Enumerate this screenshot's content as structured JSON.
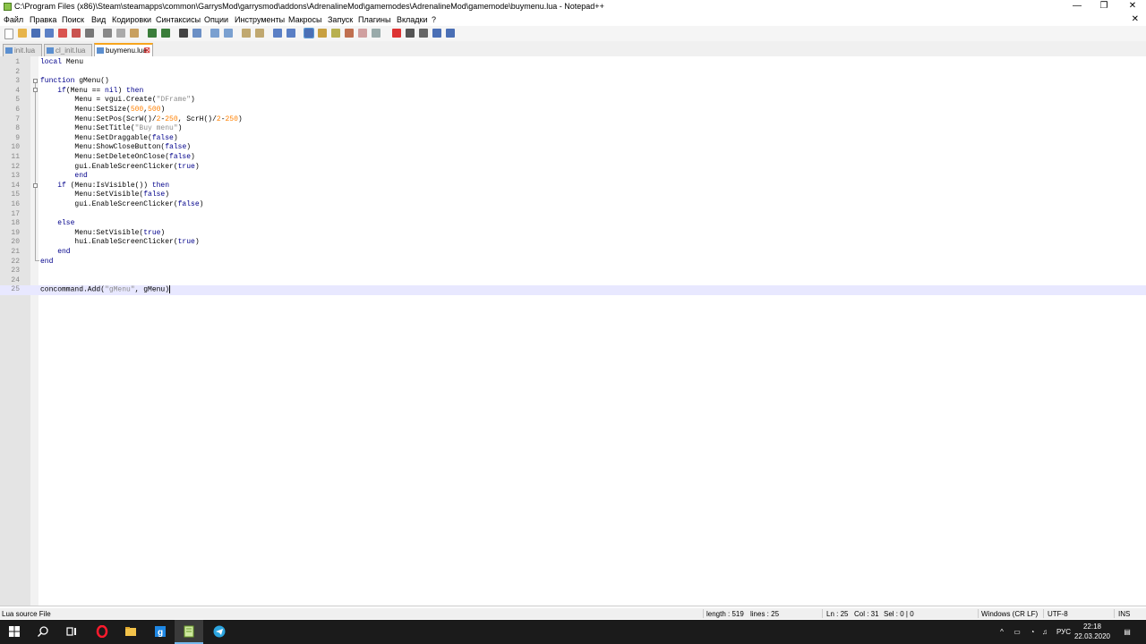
{
  "window": {
    "title": "C:\\Program Files (x86)\\Steam\\steamapps\\common\\GarrysMod\\garrysmod\\addons\\AdrenalineMod\\gamemodes\\AdrenalineMod\\gamemode\\buymenu.lua - Notepad++",
    "minimize": "—",
    "restore": "❐",
    "close": "✕"
  },
  "menu": [
    "Файл",
    "Правка",
    "Поиск",
    "Вид",
    "Кодировки",
    "Синтаксисы",
    "Опции",
    "Инструменты",
    "Макросы",
    "Запуск",
    "Плагины",
    "Вкладки",
    "?"
  ],
  "menu_close": "✕",
  "tabs": [
    {
      "label": "init.lua",
      "active": false
    },
    {
      "label": "cl_init.lua",
      "active": false
    },
    {
      "label": "buymenu.lua",
      "active": true
    }
  ],
  "code_lines": [
    "1",
    "2",
    "3",
    "4",
    "5",
    "6",
    "7",
    "8",
    "9",
    "10",
    "11",
    "12",
    "13",
    "14",
    "15",
    "16",
    "17",
    "18",
    "19",
    "20",
    "21",
    "22",
    "23",
    "24",
    "25"
  ],
  "code": {
    "l1_kw": "local",
    "l1_rest": " Menu",
    "l3_kw": "function",
    "l3_rest": " gMenu()",
    "l4_kw1": "if",
    "l4_mid": "(Menu == ",
    "l4_kw2": "nil",
    "l4_end": ") ",
    "l4_kw3": "then",
    "l5_a": "Menu = vgui.Create(",
    "l5_str": "\"DFrame\"",
    "l5_b": ")",
    "l6_a": "Menu:SetSize(",
    "l6_n1": "500",
    "l6_c": ",",
    "l6_n2": "500",
    "l6_b": ")",
    "l7_a": "Menu:SetPos(ScrW()/",
    "l7_n1": "2",
    "l7_m1": "-",
    "l7_n2": "250",
    "l7_m2": ", ScrH()/",
    "l7_n3": "2",
    "l7_m3": "-",
    "l7_n4": "250",
    "l7_b": ")",
    "l8_a": "Menu:SetTitle(",
    "l8_str": "\"Buy menu\"",
    "l8_b": ")",
    "l9_a": "Menu:SetDraggable(",
    "l9_kw": "false",
    "l9_b": ")",
    "l10_a": "Menu:ShowCloseButton(",
    "l10_kw": "false",
    "l10_b": ")",
    "l11_a": "Menu:SetDeleteOnClose(",
    "l11_kw": "false",
    "l11_b": ")",
    "l12_a": "gui.EnableScreenClicker(",
    "l12_kw": "true",
    "l12_b": ")",
    "l13_kw": "end",
    "l14_kw1": "if",
    "l14_mid": " (Menu:IsVisible()) ",
    "l14_kw2": "then",
    "l15_a": "Menu:SetVisible(",
    "l15_kw": "false",
    "l15_b": ")",
    "l16_a": "gui.EnableScreenClicker(",
    "l16_kw": "false",
    "l16_b": ")",
    "l18_kw": "else",
    "l19_a": "Menu:SetVisible(",
    "l19_kw": "true",
    "l19_b": ")",
    "l20_a": "hui.EnableScreenClicker(",
    "l20_kw": "true",
    "l20_b": ")",
    "l21_kw": "end",
    "l22_kw": "end",
    "l25_a": "concommand.Add(",
    "l25_str": "\"gMenu\"",
    "l25_b": ", gMenu)"
  },
  "status": {
    "file_type": "Lua source File",
    "length": "length : 519",
    "lines": "lines : 25",
    "ln": "Ln : 25",
    "col": "Col : 31",
    "sel": "Sel : 0 | 0",
    "eol": "Windows (CR LF)",
    "encoding": "UTF-8",
    "mode": "INS"
  },
  "tray": {
    "lang": "РУС",
    "time": "22:18",
    "date": "22.03.2020",
    "chevron": "^"
  },
  "colors": {
    "keyword": "#00008b",
    "string": "#8e8e8e",
    "number": "#ff8000",
    "active_tab_accent": "#f7a51c",
    "taskbar": "#1b1b1b"
  }
}
